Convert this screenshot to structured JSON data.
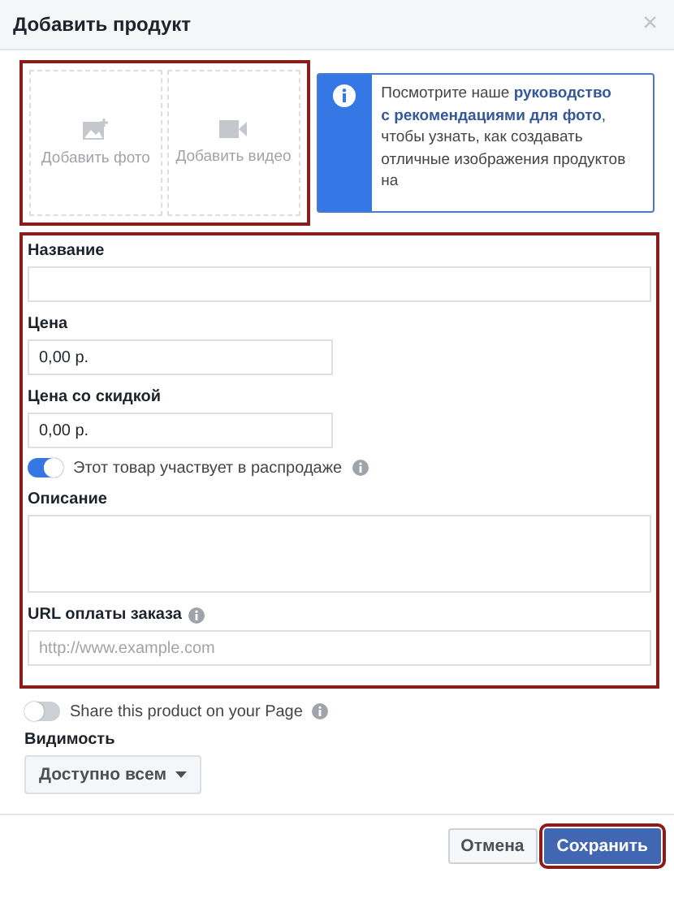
{
  "window": {
    "title": "Добавить продукт",
    "close": "×"
  },
  "media": {
    "highlighted": true,
    "slots": [
      {
        "kind": "photo",
        "label": "Добавить фото"
      },
      {
        "kind": "video",
        "label": "Добавить видео"
      }
    ]
  },
  "info": {
    "before": "Посмотрите наше",
    "links": [
      "руководство",
      "с рекомендациями для фото"
    ],
    "after": ", чтобы узнать, как создавать отличные изображения продуктов на"
  },
  "form": {
    "highlighted": true,
    "fields": [
      {
        "kind": "text",
        "label": "Название"
      },
      {
        "kind": "short",
        "label": "Цена",
        "value": "0,00 р."
      },
      {
        "kind": "short",
        "label": "Цена со скидкой",
        "value": "0,00 р."
      },
      {
        "kind": "toggle",
        "label": "Этот товар участвует в распродаже",
        "on": true,
        "info": true
      },
      {
        "kind": "textarea",
        "label": "Описание"
      },
      {
        "kind": "url",
        "label": "URL оплаты заказа",
        "info": true,
        "placeholder": "http://www.example.com"
      }
    ]
  },
  "share": {
    "label": "Share this product on your Page",
    "on": false,
    "info": true
  },
  "visibility": {
    "label": "Видимость",
    "value": "Доступно всем"
  },
  "buttons": [
    {
      "kind": "cancel",
      "label": "Отмена",
      "highlighted": false
    },
    {
      "kind": "save",
      "label": "Сохранить",
      "highlighted": true
    }
  ]
}
